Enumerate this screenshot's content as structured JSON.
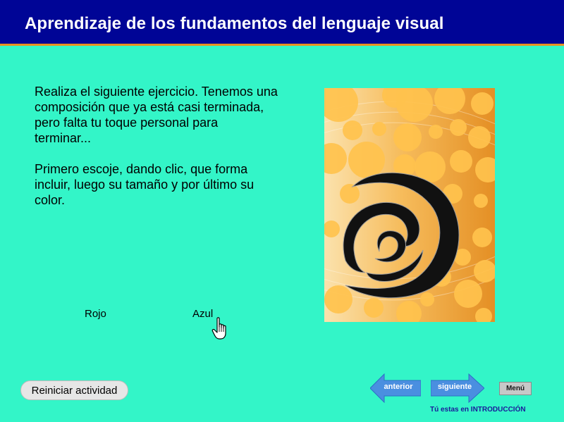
{
  "header": {
    "title": "Aprendizaje de los fundamentos del lenguaje visual"
  },
  "instructions": {
    "paragraph1": "Realiza el siguiente ejercicio. Tenemos una composición que ya está casi terminada, pero falta tu toque personal para terminar...",
    "paragraph2": "Primero escoje, dando clic, que forma incluir, luego su tamaño y por último su color."
  },
  "color_options": [
    {
      "label": "Rojo"
    },
    {
      "label": "Azul"
    }
  ],
  "artwork": {
    "name": "composition-artwork"
  },
  "buttons": {
    "reset": "Reiniciar actividad",
    "prev": "anterior",
    "next": "siguiente",
    "menu": "Menú"
  },
  "location": {
    "text": "Tú estas en INTRODUCCIÓN"
  },
  "colors": {
    "header_bg": "#000596",
    "header_border": "#e8901f",
    "page_bg": "#33f5c8",
    "nav_blue": "#4a8fe0"
  }
}
